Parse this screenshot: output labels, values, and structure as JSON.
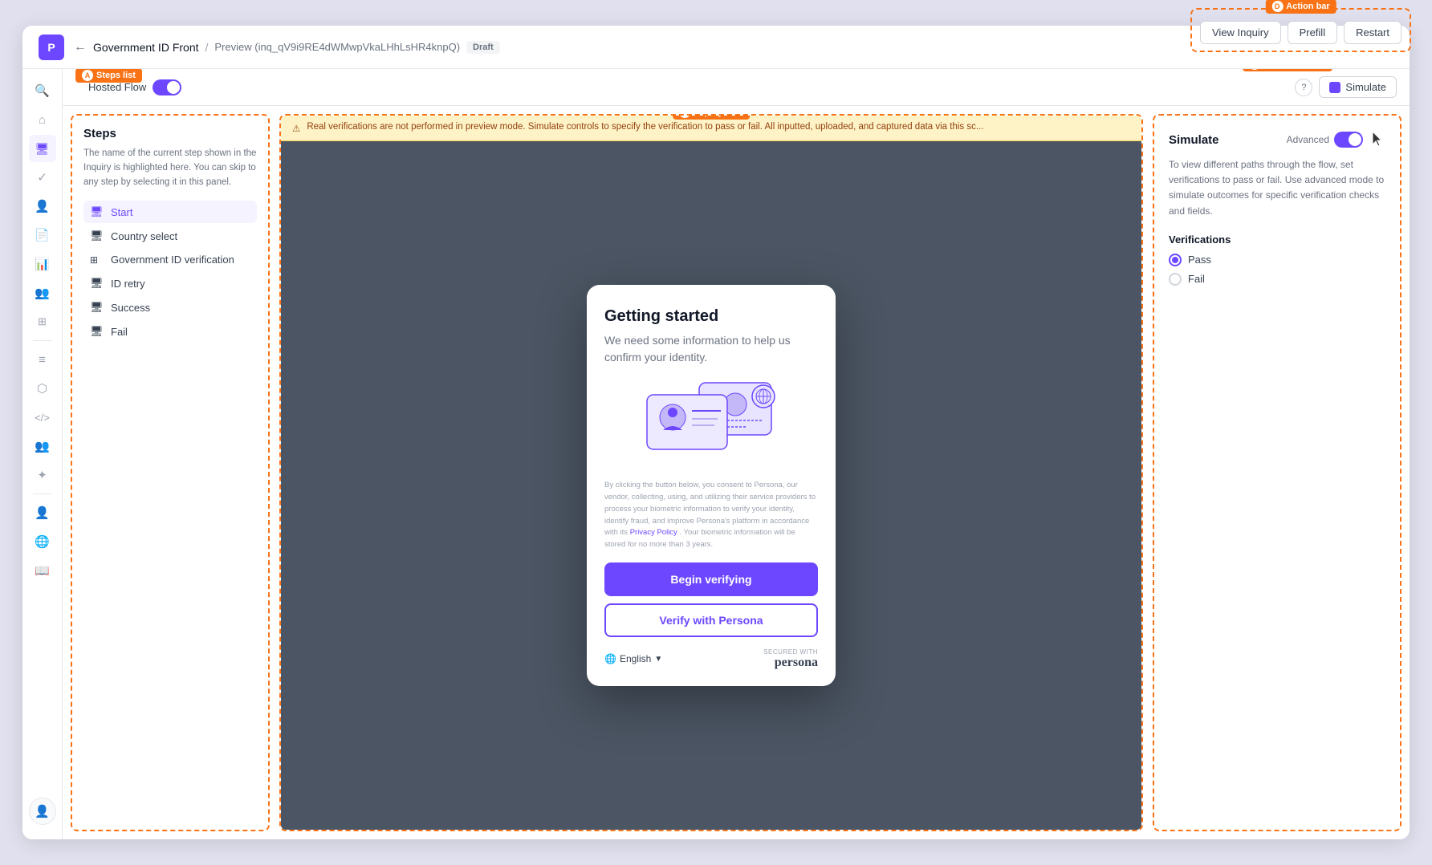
{
  "app": {
    "logo": "P",
    "page_name": "Government ID Front",
    "preview_id": "Preview (inq_qV9i9RE4dWMwpVkaLHhLsHR4knpQ)",
    "draft_badge": "Draft"
  },
  "breadcrumb": {
    "back_arrow": "←",
    "separator": "/"
  },
  "action_bar": {
    "label": "Action bar",
    "label_letter": "D",
    "view_inquiry": "View Inquiry",
    "prefill": "Prefill",
    "restart": "Restart"
  },
  "toolbar": {
    "steps_list_label": "Steps list",
    "steps_list_letter": "A",
    "hosted_flow_label": "Hosted Flow",
    "inquiry_flow_label": "Inquiry flow",
    "inquiry_flow_letter": "B",
    "simulate_panel_label": "Simulate panel",
    "simulate_panel_letter": "C",
    "simulate_btn": "Simulate"
  },
  "steps_panel": {
    "title": "Steps",
    "description": "The name of the current step shown in the Inquiry is highlighted here. You can skip to any step by selecting it in this panel.",
    "items": [
      {
        "id": "start",
        "label": "Start",
        "icon": "🖥",
        "active": true
      },
      {
        "id": "country-select",
        "label": "Country select",
        "icon": "🖥",
        "active": false
      },
      {
        "id": "government-id",
        "label": "Government ID verification",
        "icon": "⊞",
        "active": false
      },
      {
        "id": "id-retry",
        "label": "ID retry",
        "icon": "🖥",
        "active": false
      },
      {
        "id": "success",
        "label": "Success",
        "icon": "🖥",
        "active": false
      },
      {
        "id": "fail",
        "label": "Fail",
        "icon": "🖥",
        "active": false
      }
    ]
  },
  "notification_bar": {
    "icon": "⚠",
    "text": "Real verifications are not performed in preview mode. Simulate controls to specify the verification to pass or fail. All inputted, uploaded, and captured data via this sc..."
  },
  "phone_card": {
    "title": "Getting started",
    "subtitle": "We need some information to help us confirm your identity.",
    "consent_text": "By clicking the button below, you consent to Persona, our vendor, collecting, using, and utilizing their service providers to process your biometric information to verify your identity, identify fraud, and improve Persona's platform in accordance with its",
    "privacy_policy_link": "Privacy Policy",
    "consent_text_end": ". Your biometric information will be stored for no more than 3 years.",
    "begin_verifying": "Begin verifying",
    "verify_with_persona": "Verify with Persona",
    "language": "English",
    "secured_with": "SECURED WITH",
    "persona_brand": "persona"
  },
  "simulate_panel": {
    "title": "Simulate",
    "advanced_label": "Advanced",
    "description": "To view different paths through the flow, set verifications to pass or fail. Use advanced mode to simulate outcomes for specific verification checks and fields.",
    "verifications_title": "Verifications",
    "options": [
      {
        "id": "pass",
        "label": "Pass",
        "selected": true
      },
      {
        "id": "fail",
        "label": "Fail",
        "selected": false
      }
    ]
  },
  "sidebar": {
    "icons": [
      {
        "id": "search",
        "icon": "🔍",
        "active": false
      },
      {
        "id": "home",
        "icon": "⌂",
        "active": false
      },
      {
        "id": "monitor",
        "icon": "🖥",
        "active": true
      },
      {
        "id": "check",
        "icon": "✓",
        "active": false
      },
      {
        "id": "user",
        "icon": "👤",
        "active": false
      },
      {
        "id": "file",
        "icon": "📄",
        "active": false
      },
      {
        "id": "chart",
        "icon": "📊",
        "active": false
      },
      {
        "id": "users",
        "icon": "👥",
        "active": false
      },
      {
        "id": "flow",
        "icon": "⬡",
        "active": false
      },
      {
        "id": "list",
        "icon": "≡",
        "active": false
      },
      {
        "id": "grid",
        "icon": "⊞",
        "active": false
      },
      {
        "id": "code",
        "icon": "<>",
        "active": false
      },
      {
        "id": "team",
        "icon": "👥",
        "active": false
      },
      {
        "id": "spark",
        "icon": "✦",
        "active": false
      },
      {
        "id": "user-settings",
        "icon": "👤",
        "active": false
      },
      {
        "id": "globe",
        "icon": "🌐",
        "active": false
      },
      {
        "id": "book",
        "icon": "📖",
        "active": false
      }
    ]
  },
  "colors": {
    "persona_purple": "#6c47ff",
    "orange_border": "#f97316",
    "draft_bg": "#f3f4f6"
  }
}
